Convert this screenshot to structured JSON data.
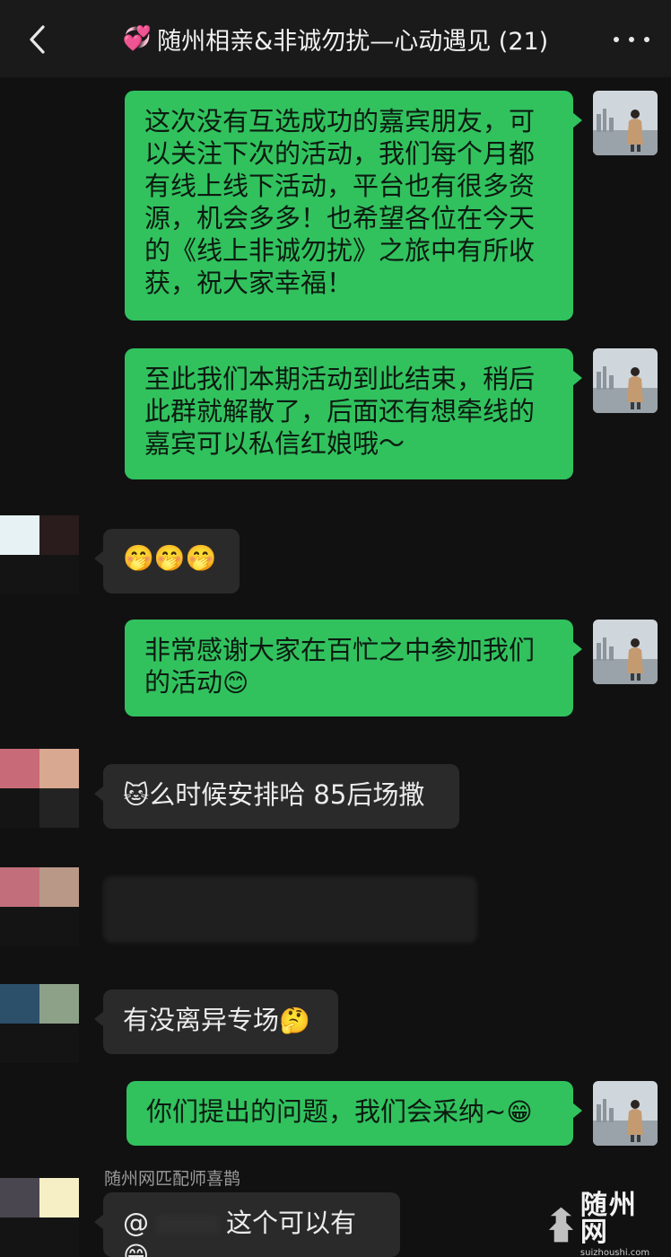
{
  "header": {
    "title_emoji": "💞",
    "title": "随州相亲&非诚勿扰—心动遇见 (21)"
  },
  "messages": {
    "m1": "这次没有互选成功的嘉宾朋友，可以关注下次的活动，我们每个月都有线上线下活动，平台也有很多资源，机会多多！也希望各位在今天的《线上非诚勿扰》之旅中有所收获，祝大家幸福！",
    "m2": "至此我们本期活动到此结束，稍后此群就解散了，后面还有想牵线的嘉宾可以私信红娘哦～",
    "m3": "🤭🤭🤭",
    "m4_text": "非常感谢大家在百忙之中参加我们的活动",
    "m4_emoji": "😊",
    "m5_emoji": "🐱",
    "m5_text": "么时候安排哈 85后场撒",
    "m7_text": "有没离异专场",
    "m7_emoji": "🤔",
    "m8_text": "你们提出的问题，我们会采纳~",
    "m8_emoji": "😁",
    "m9_sender": "随州网匹配师喜鹊",
    "m9_at": "@",
    "m9_text": "这个可以有",
    "m9_emoji": "😁"
  },
  "avatars": {
    "a1": [
      "#e6f2f3",
      "#2a1c1d",
      "#141414",
      "#141414"
    ],
    "a2": [
      "#c96a78",
      "#d8a890",
      "#141414",
      "#232323"
    ],
    "a3": [
      "#c36f7b",
      "#b99888",
      "#141414",
      "#141414"
    ],
    "a4": [
      "#2c4f6a",
      "#8da088",
      "#141414",
      "#141414"
    ],
    "a5": [
      "#4a4650",
      "#f6eec4",
      "#141414",
      "#141414"
    ]
  },
  "watermark": {
    "main": "随州网",
    "sub": "suizhoushi.com"
  },
  "colors": {
    "outgoing_bubble": "#31c25e",
    "incoming_bubble": "#2a2a2a",
    "background": "#111111"
  }
}
